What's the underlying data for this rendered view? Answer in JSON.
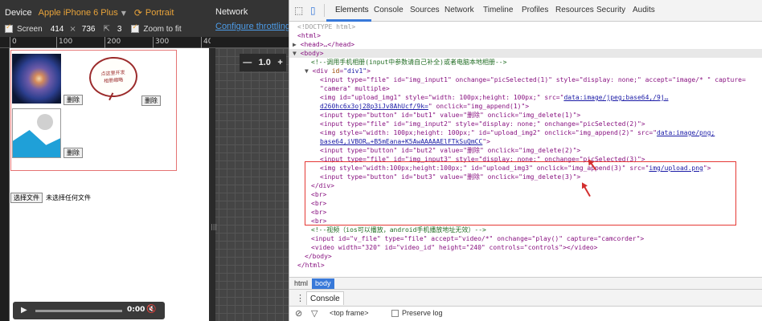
{
  "device_toolbar": {
    "device_label": "Device",
    "device_value": "Apple iPhone 6 Plus",
    "orientation": "Portrait",
    "screen_label": "Screen",
    "width": "414",
    "times": "×",
    "height": "736",
    "dpr": "3",
    "zoom_label": "Zoom to fit"
  },
  "ruler_ticks": [
    "0",
    "100",
    "200",
    "300",
    "400"
  ],
  "viewport": {
    "bubble_line1": "点这里开发",
    "bubble_line2": "相册缩略",
    "delete_label": "删除",
    "file_button": "选择文件",
    "file_status": "未选择任何文件",
    "video_time": "0:00"
  },
  "network": {
    "label": "Network",
    "throttle_link": "Configure throttling"
  },
  "zoom": {
    "minus": "—",
    "value": "1.0",
    "plus": "+"
  },
  "devtools": {
    "tabs": [
      "Elements",
      "Console",
      "Sources",
      "Network",
      "Timeline",
      "Profiles",
      "Resources",
      "Security",
      "Audits"
    ],
    "active_tab": "Elements",
    "breadcrumbs": [
      "html",
      "body"
    ],
    "drawer_tab": "Console",
    "frame_selector": "<top frame>",
    "preserve_log": "Preserve log"
  },
  "dom": {
    "doctype": "<!DOCTYPE html>",
    "html_open": "<html>",
    "head": "<head>…</head>",
    "body_open": "<body>",
    "comment1": "<!--调用手机相册(input中参数请自己补全)或者电脑本地相册-->",
    "div_open_1": "<div",
    "div_id": "\"div1\"",
    "div_open_2": ">",
    "l_input1_a": "<input type=\"file\" id=\"img_input1\" onchange=\"picSelected(1)\" style=\"display: none;\" accept=\"image/* \" capture=",
    "l_input1_b": "\"camera\" multiple>",
    "l_img1_a": "<img id=\"upload_img1\" style=\"width: 100px;height: 100px;\" src=\"",
    "l_img1_src": "data:image/jpeg;base64,/9j…",
    "l_img1_b": "d260hc6x3oj28p3iJv8AhUcf/9k=",
    "l_img1_c": "\" onclick=\"img_append(1)\">",
    "l_but1": "<input type=\"button\" id=\"but1\" value=\"删除\" onclick=\"img_delete(1)\">",
    "l_input2": "<input type=\"file\" id=\"img_input2\" style=\"display: none;\" onchange=\"picSelected(2)\">",
    "l_img2_a": "<img style=\"width: 100px;height: 100px;\" id=\"upload_img2\" onclick=\"img_append(2)\" src=\"",
    "l_img2_src": "data:image/png;",
    "l_img2_b": "base64,iVBOR…+B5mEana+K5AwAAAAAElFTkSuQmCC",
    "l_img2_c": "\">",
    "l_but2": "<input type=\"button\" id=\"but2\" value=\"删除\" onclick=\"img_delete(2)\">",
    "l_input3": "<input type=\"file\" id=\"img_input3\" style=\"display: none;\" onchange=\"picSelected(3)\">",
    "l_img3_a": "<img style=\"width:100px;height:100px;\" id=\"upload_img3\" onclick=\"img_append(3)\" src=\"",
    "l_img3_src": "img/upload.png",
    "l_img3_b": "\">",
    "l_but3": "<input type=\"button\" id=\"but3\" value=\"删除\" onclick=\"img_delete(3)\">",
    "div_close": "</div>",
    "br": "<br>",
    "comment2": "<!--视频（ios可以播放，android手机播放地址无效）-->",
    "l_vfile": "<input id=\"v_file\" type=\"file\" accept=\"video/*\" onchange=\"play()\" capture=\"camcorder\">",
    "l_video": "<video width=\"320\" id=\"video_id\" height=\"240\" controls=\"controls\"></video>",
    "body_close": "</body>",
    "html_close": "</html>"
  },
  "colors": {
    "accent_orange": "#e8a33a",
    "devtools_blue": "#3879d9",
    "annotation_red": "#e53935"
  }
}
